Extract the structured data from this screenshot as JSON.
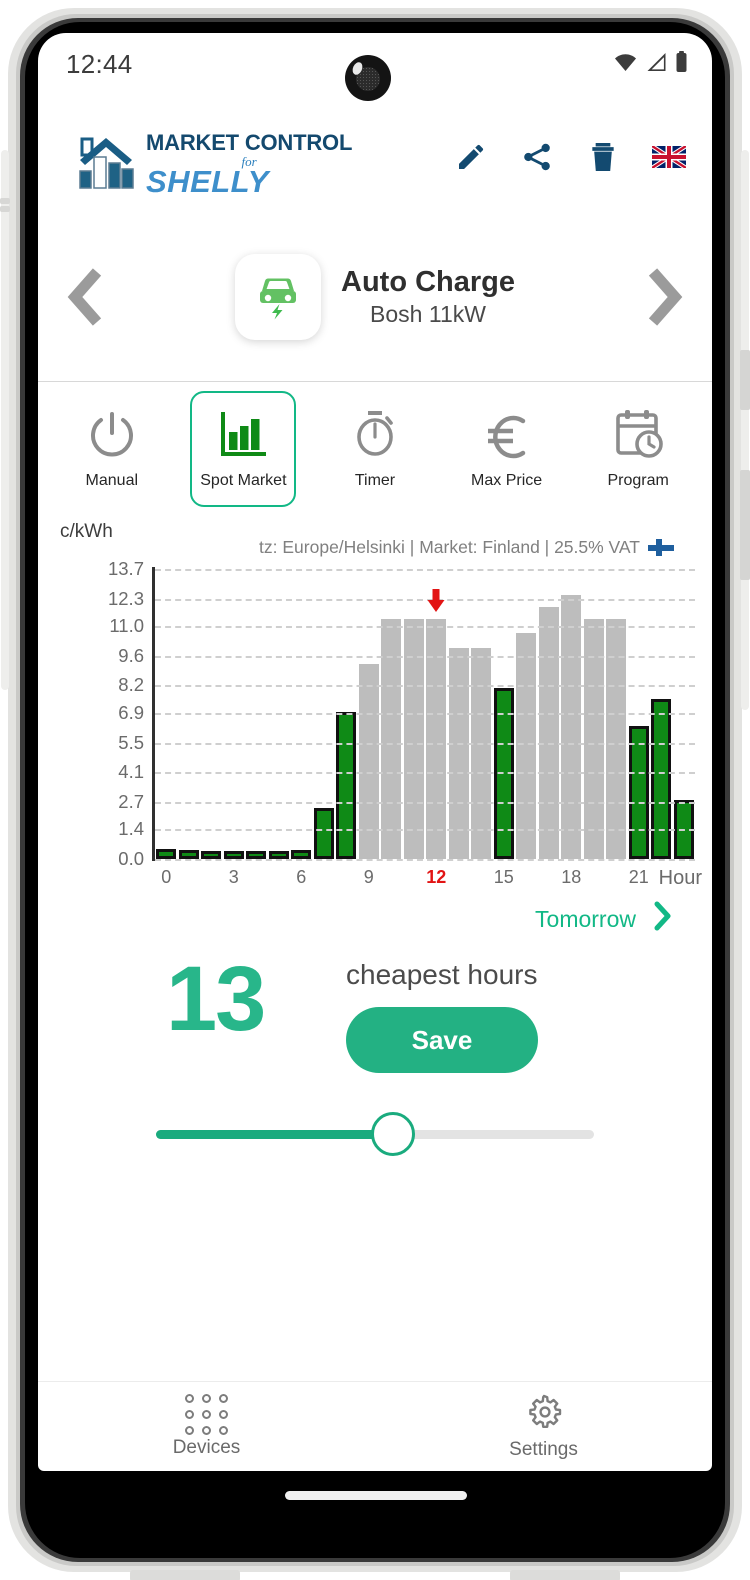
{
  "status_bar": {
    "time": "12:44",
    "icons": [
      "wifi-icon",
      "cellular-signal-icon",
      "battery-icon"
    ]
  },
  "header": {
    "logo_line1": "MARKET CONTROL",
    "logo_for": "for",
    "logo_line2": "SHELLY",
    "actions": [
      {
        "name": "edit-button",
        "icon": "pencil-icon"
      },
      {
        "name": "share-button",
        "icon": "share-icon"
      },
      {
        "name": "delete-button",
        "icon": "trash-icon"
      },
      {
        "name": "language-button",
        "icon": "uk-flag-icon"
      }
    ]
  },
  "device": {
    "prev_label": "‹",
    "next_label": "›",
    "icon": "electric-car-icon",
    "name": "Auto Charge",
    "subtitle": "Bosh 11kW"
  },
  "modes": [
    {
      "label": "Manual",
      "icon": "power-icon",
      "active": false
    },
    {
      "label": "Spot Market",
      "icon": "bar-chart-icon",
      "active": true
    },
    {
      "label": "Timer",
      "icon": "stopwatch-icon",
      "active": false
    },
    {
      "label": "Max Price",
      "icon": "euro-icon",
      "active": false
    },
    {
      "label": "Program",
      "icon": "calendar-clock-icon",
      "active": false
    }
  ],
  "chart_meta": {
    "unit_label": "c/kWh",
    "info_text": "tz: Europe/Helsinki | Market: Finland | 25.5% VAT",
    "flag": "finland-flag-icon",
    "tomorrow_label": "Tomorrow",
    "tomorrow_icon": "chevron-right-icon"
  },
  "chart_data": {
    "type": "bar",
    "title": "",
    "xlabel": "Hour",
    "ylabel": "c/kWh",
    "ylim": [
      0.0,
      13.7
    ],
    "grid": true,
    "categories": [
      "0",
      "1",
      "2",
      "3",
      "4",
      "5",
      "6",
      "7",
      "8",
      "9",
      "10",
      "11",
      "12",
      "13",
      "14",
      "15",
      "16",
      "17",
      "18",
      "19",
      "20",
      "21",
      "22",
      "23"
    ],
    "values": [
      0.45,
      0.42,
      0.38,
      0.38,
      0.4,
      0.4,
      0.44,
      2.4,
      6.95,
      9.2,
      11.35,
      11.35,
      11.35,
      9.95,
      9.95,
      8.1,
      10.7,
      11.9,
      12.45,
      11.35,
      11.35,
      6.3,
      7.55,
      2.8
    ],
    "selected": [
      true,
      true,
      true,
      true,
      true,
      true,
      true,
      true,
      true,
      false,
      false,
      false,
      false,
      false,
      false,
      true,
      false,
      false,
      false,
      false,
      false,
      true,
      true,
      true
    ],
    "ytick_labels": [
      "13.7",
      "12.3",
      "11.0",
      "9.6",
      "8.2",
      "6.9",
      "5.5",
      "4.1",
      "2.7",
      "1.4",
      "0.0"
    ],
    "ytick_values": [
      13.7,
      12.3,
      11.0,
      9.6,
      8.2,
      6.9,
      5.5,
      4.1,
      2.7,
      1.4,
      0.0
    ],
    "xtick_labels": [
      "0",
      "3",
      "6",
      "9",
      "12",
      "15",
      "18",
      "21"
    ],
    "xtick_positions": [
      0,
      3,
      6,
      9,
      12,
      15,
      18,
      21
    ],
    "current_hour": 12,
    "current_hour_marker": "red-down-arrow",
    "colors": {
      "selected": "#0f8a16",
      "unselected": "#bdbdbd",
      "current": "#e21414"
    }
  },
  "cheapest": {
    "count": "13",
    "label": "cheapest hours",
    "save_label": "Save"
  },
  "slider": {
    "value": 13,
    "min": 0,
    "max": 24,
    "percent": 54,
    "accent": "#1aab7e"
  },
  "bottom_nav": [
    {
      "label": "Devices",
      "icon": "apps-grid-icon"
    },
    {
      "label": "Settings",
      "icon": "gear-icon"
    }
  ]
}
